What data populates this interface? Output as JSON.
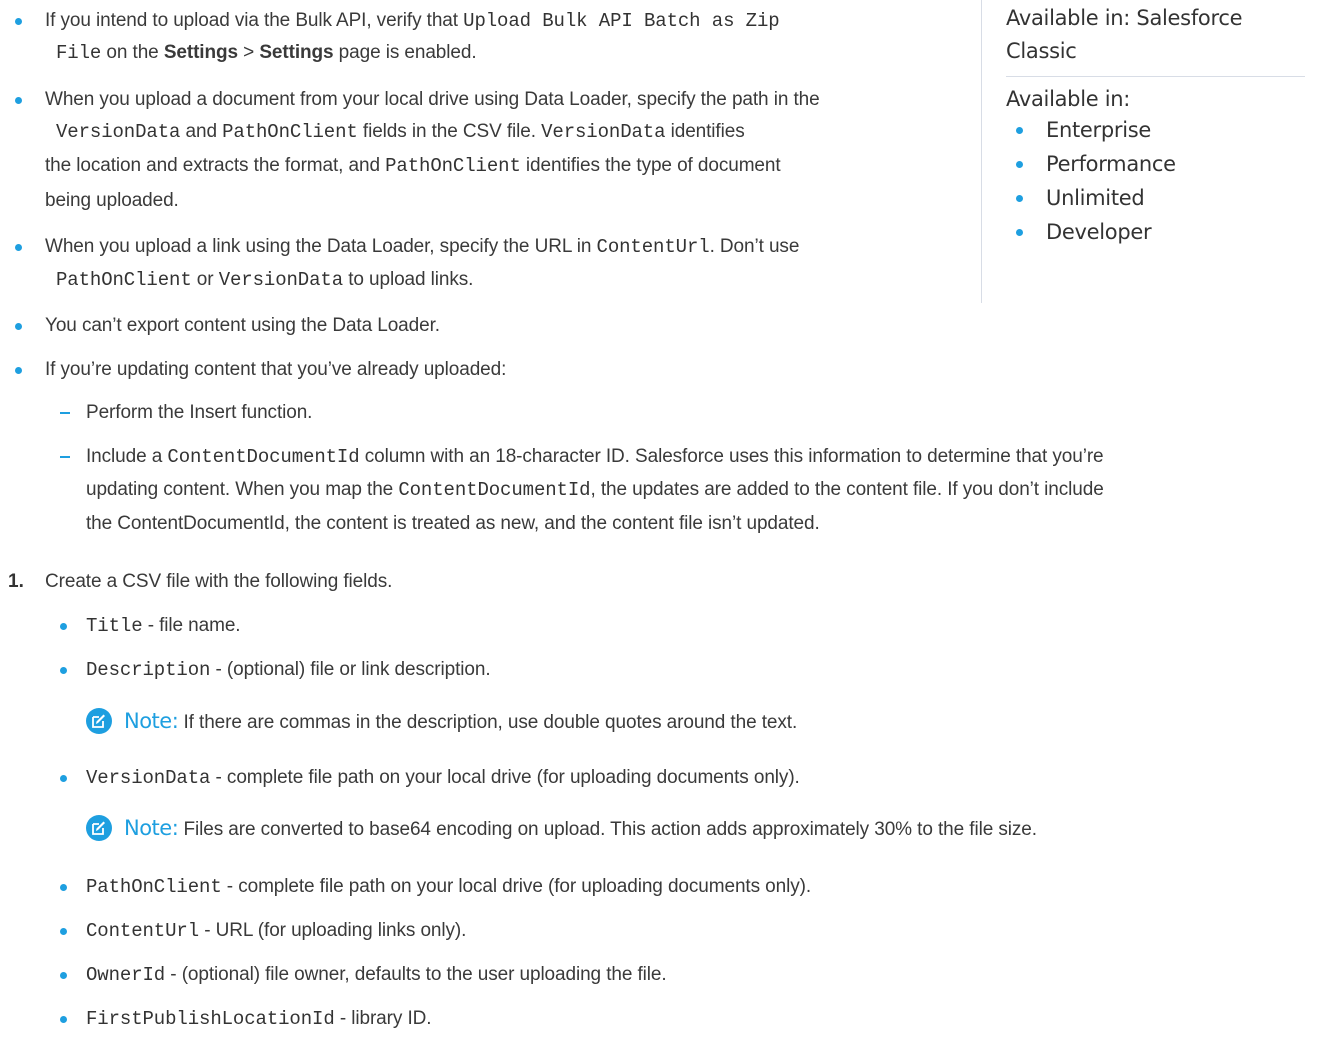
{
  "sidebar": {
    "available_classic_1": "Available in: Salesforce",
    "available_classic_2": "Classic",
    "available_in": "Available in:",
    "editions": [
      "Enterprise",
      "Performance",
      "Unlimited",
      "Developer"
    ]
  },
  "bullets": {
    "b1": {
      "t1": "If you intend to upload via the Bulk API, verify that ",
      "c1": "Upload Bulk API Batch as Zip",
      "c2": "File",
      "t2": " on the ",
      "s1": "Settings",
      "t3": " > ",
      "s2": "Settings",
      "t4": " page is enabled."
    },
    "b2": {
      "l1": "When you upload a document from your local drive using Data Loader, specify the path in the",
      "c1": "VersionData",
      "t1": " and ",
      "c2": "PathOnClient",
      "t2": " fields in the CSV file. ",
      "c3": "VersionData",
      "t3": " identifies",
      "l3a": "the location and extracts the format, and ",
      "c4": "PathOnClient",
      "l3b": " identifies the type of document",
      "l4": "being uploaded."
    },
    "b3": {
      "t1": "When you upload a link using the Data Loader, specify the URL in ",
      "c1": "ContentUrl",
      "t2": ". Don’t use",
      "c2": "PathOnClient",
      "t3": " or ",
      "c3": "VersionData",
      "t4": " to upload links."
    },
    "b4": "You can’t export content using the Data Loader.",
    "b5": "If you’re updating content that you’ve already uploaded:",
    "d1": "Perform the Insert function.",
    "d2": {
      "t1": "Include a ",
      "c1": "ContentDocumentId",
      "t2": " column with an 18-character ID. Salesforce uses this information to determine that you’re",
      "l2a": "updating content. When you map the ",
      "c2": "ContentDocumentId",
      "l2b": ", the updates are added to the content file. If you don’t include",
      "l3": "the ContentDocumentId, the content is treated as new, and the content file isn’t updated."
    }
  },
  "step1": {
    "number": "1.",
    "text": "Create a CSV file with the following fields.",
    "fields": [
      {
        "code": "Title",
        "desc": " - file name."
      },
      {
        "code": "Description",
        "desc": " - (optional) file or link description."
      },
      {
        "code": "VersionData",
        "desc": " - complete file path on your local drive (for uploading documents only)."
      },
      {
        "code": "PathOnClient",
        "desc": " - complete file path on your local drive (for uploading documents only)."
      },
      {
        "code": "ContentUrl",
        "desc": " - URL (for uploading links only)."
      },
      {
        "code": "OwnerId",
        "desc": " - (optional) file owner, defaults to the user uploading the file."
      },
      {
        "code": "FirstPublishLocationId",
        "desc": " - library ID."
      }
    ],
    "note1": {
      "label": "Note:",
      "text": "If there are commas in the description, use double quotes around the text."
    },
    "note2": {
      "label": "Note:",
      "text": "Files are converted to base64 encoding on upload. This action adds approximately 30% to the file size."
    }
  },
  "colors": {
    "accent": "#1e9fe0",
    "text": "#3a3a3a",
    "divider": "#d8dde6"
  },
  "icons": {
    "note": "edit-note-icon",
    "bullet": "bullet-dot-icon",
    "dash": "dash-bullet-icon"
  }
}
